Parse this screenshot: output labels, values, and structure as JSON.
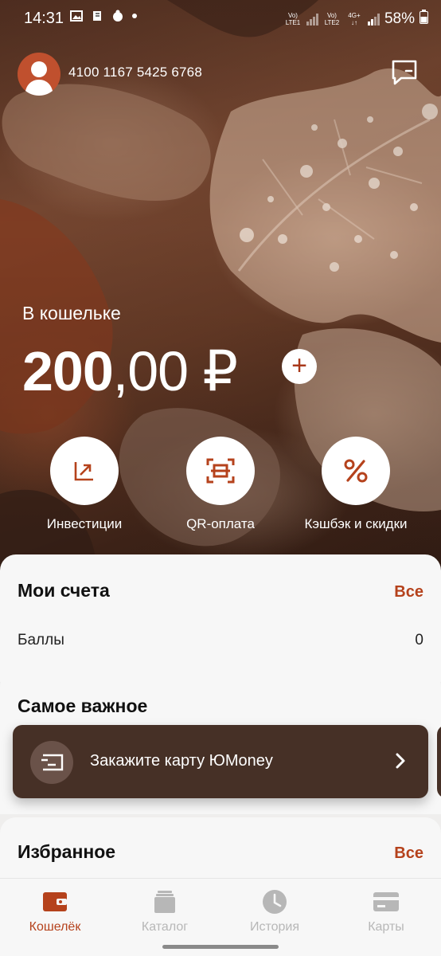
{
  "status_bar": {
    "time": "14:31",
    "net1_top": "Vo)",
    "net1_bottom": "LTE1",
    "net2_top": "Vo)",
    "net2_bottom": "LTE2",
    "net2_type": "4G+",
    "battery": "58%"
  },
  "account": {
    "number": "4100 1167 5425 6768"
  },
  "wallet": {
    "label": "В кошельке",
    "balance_int": "200",
    "balance_frac": ",00 ₽"
  },
  "actions": [
    {
      "label": "Инвестиции",
      "icon": "chart-arrow-icon"
    },
    {
      "label": "QR-оплата",
      "icon": "qr-scan-icon"
    },
    {
      "label": "Кэшбэк и скидки",
      "icon": "percent-icon"
    }
  ],
  "accounts_section": {
    "title": "Мои счета",
    "all_label": "Все",
    "rows": [
      {
        "label": "Баллы",
        "value": "0"
      }
    ]
  },
  "important_section": {
    "title": "Самое важное",
    "promo_text": "Закажите карту ЮMoney"
  },
  "favorites_section": {
    "title": "Избранное",
    "all_label": "Все"
  },
  "nav": [
    {
      "label": "Кошелёк",
      "icon": "wallet-icon",
      "active": true
    },
    {
      "label": "Каталог",
      "icon": "catalog-icon",
      "active": false
    },
    {
      "label": "История",
      "icon": "clock-icon",
      "active": false
    },
    {
      "label": "Карты",
      "icon": "card-icon",
      "active": false
    }
  ],
  "colors": {
    "accent": "#b5421c",
    "promo_bg": "#463026",
    "nav_inactive": "#b7b7b7"
  }
}
